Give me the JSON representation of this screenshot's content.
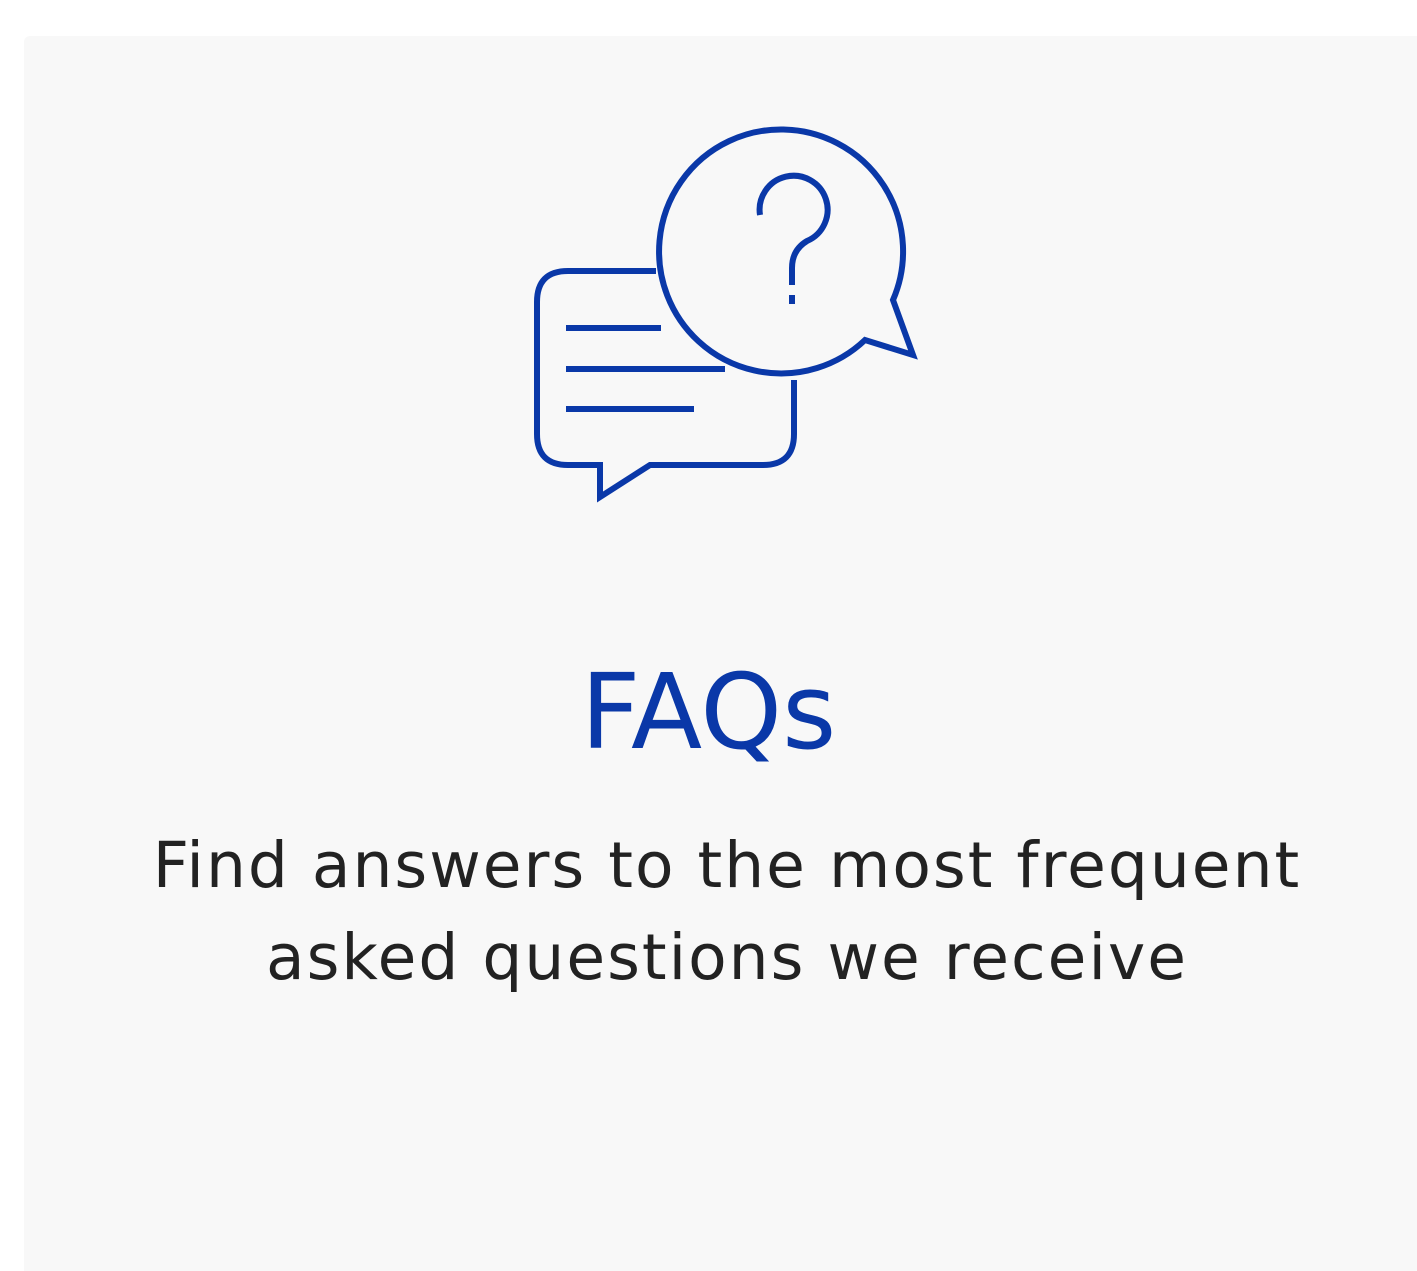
{
  "card": {
    "title": "FAQs",
    "description": "Find answers to the most frequent asked questions we receive",
    "icon": "faq-chat-bubbles-icon"
  },
  "colors": {
    "accent": "#0a38a8",
    "card_background": "#f8f8f8",
    "text": "#222222"
  }
}
